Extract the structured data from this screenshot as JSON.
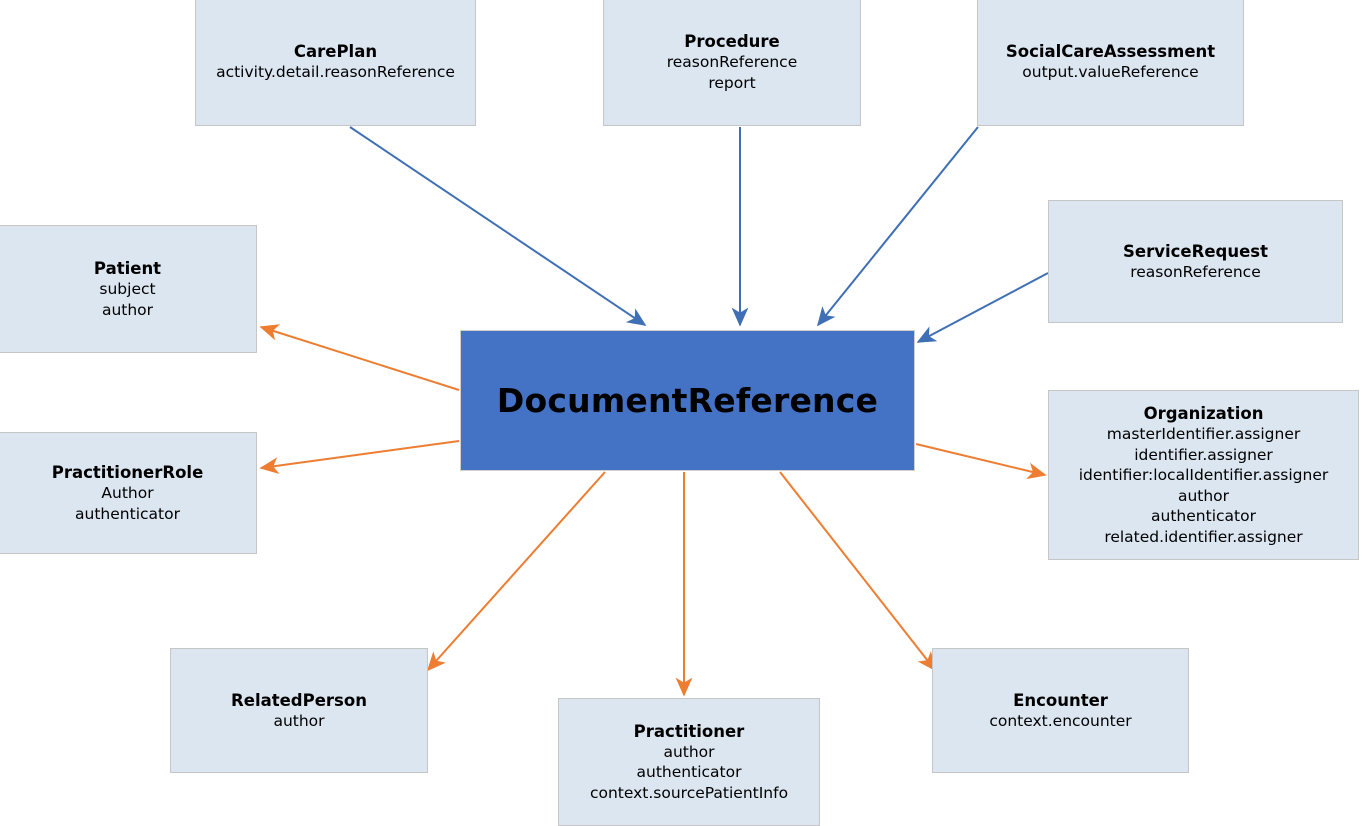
{
  "diagram": {
    "type": "entity-reference-diagram",
    "center": {
      "id": "documentreference",
      "title": "DocumentReference",
      "fields": []
    },
    "colors": {
      "center_fill": "#4472c4",
      "node_fill": "#dce6f1",
      "node_border": "#c6c6c6",
      "incoming_arrow": "#4472c4",
      "outgoing_arrow": "#ed7d31",
      "text": "#000000",
      "background": "#ffffff"
    },
    "nodes": [
      {
        "id": "careplan",
        "title": "CarePlan",
        "fields": [
          "activity.detail.reasonReference"
        ],
        "direction": "incoming"
      },
      {
        "id": "procedure",
        "title": "Procedure",
        "fields": [
          "reasonReference",
          "report"
        ],
        "direction": "incoming"
      },
      {
        "id": "socialcareassessment",
        "title": "SocialCareAssessment",
        "fields": [
          "output.valueReference"
        ],
        "direction": "incoming"
      },
      {
        "id": "servicerequest",
        "title": "ServiceRequest",
        "fields": [
          "reasonReference"
        ],
        "direction": "incoming"
      },
      {
        "id": "patient",
        "title": "Patient",
        "fields": [
          "subject",
          "author"
        ],
        "direction": "outgoing"
      },
      {
        "id": "practitionerrole",
        "title": "PractitionerRole",
        "fields": [
          "Author",
          "authenticator"
        ],
        "direction": "outgoing"
      },
      {
        "id": "organization",
        "title": "Organization",
        "fields": [
          "masterIdentifier.assigner",
          "identifier.assigner",
          "identifier:localIdentifier.assigner",
          "author",
          "authenticator",
          "related.identifier.assigner"
        ],
        "direction": "outgoing"
      },
      {
        "id": "relatedperson",
        "title": "RelatedPerson",
        "fields": [
          "author"
        ],
        "direction": "outgoing"
      },
      {
        "id": "practitioner",
        "title": "Practitioner",
        "fields": [
          "author",
          "authenticator",
          "context.sourcePatientInfo"
        ],
        "direction": "outgoing"
      },
      {
        "id": "encounter",
        "title": "Encounter",
        "fields": [
          "context.encounter"
        ],
        "direction": "outgoing"
      }
    ]
  }
}
